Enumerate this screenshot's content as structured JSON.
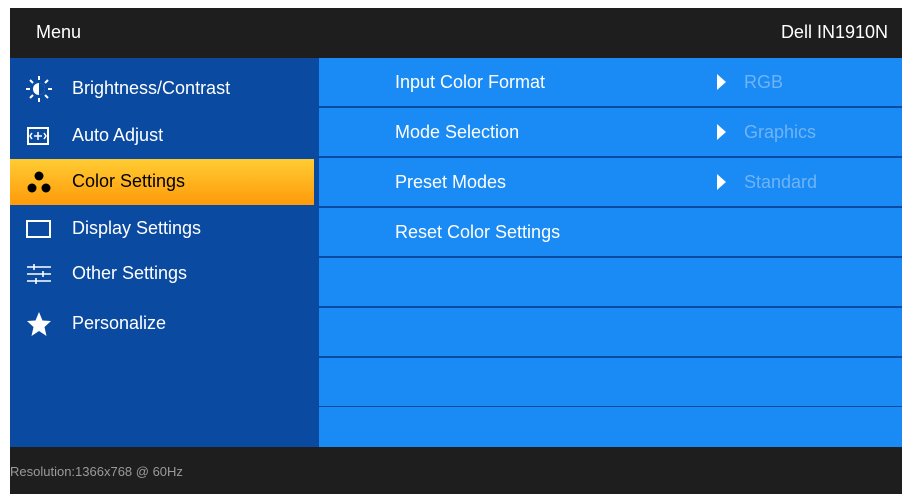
{
  "header": {
    "menu_title": "Menu",
    "model": "Dell IN1910N"
  },
  "sidebar": {
    "items": [
      {
        "label": "Brightness/Contrast",
        "icon": "brightness-icon"
      },
      {
        "label": "Auto Adjust",
        "icon": "auto-adjust-icon"
      },
      {
        "label": "Color Settings",
        "icon": "color-settings-icon",
        "selected": true
      },
      {
        "label": "Display Settings",
        "icon": "display-icon"
      },
      {
        "label": "Other Settings",
        "icon": "sliders-icon"
      },
      {
        "label": "Personalize",
        "icon": "star-icon"
      }
    ]
  },
  "content": {
    "rows": [
      {
        "label": "Input Color Format",
        "value": "RGB"
      },
      {
        "label": "Mode Selection",
        "value": "Graphics"
      },
      {
        "label": "Preset Modes",
        "value": "Standard"
      },
      {
        "label": "Reset Color Settings",
        "value": ""
      },
      {
        "label": "",
        "value": ""
      },
      {
        "label": "",
        "value": ""
      },
      {
        "label": "",
        "value": ""
      },
      {
        "label": "",
        "value": ""
      }
    ]
  },
  "footer": {
    "resolution": "Resolution:1366x768 @ 60Hz"
  },
  "colors": {
    "panel_blue": "#0a4aa0",
    "row_blue": "#1a8af5",
    "selected_orange": "#ff9a0a",
    "value_text": "#6fb4f5"
  }
}
